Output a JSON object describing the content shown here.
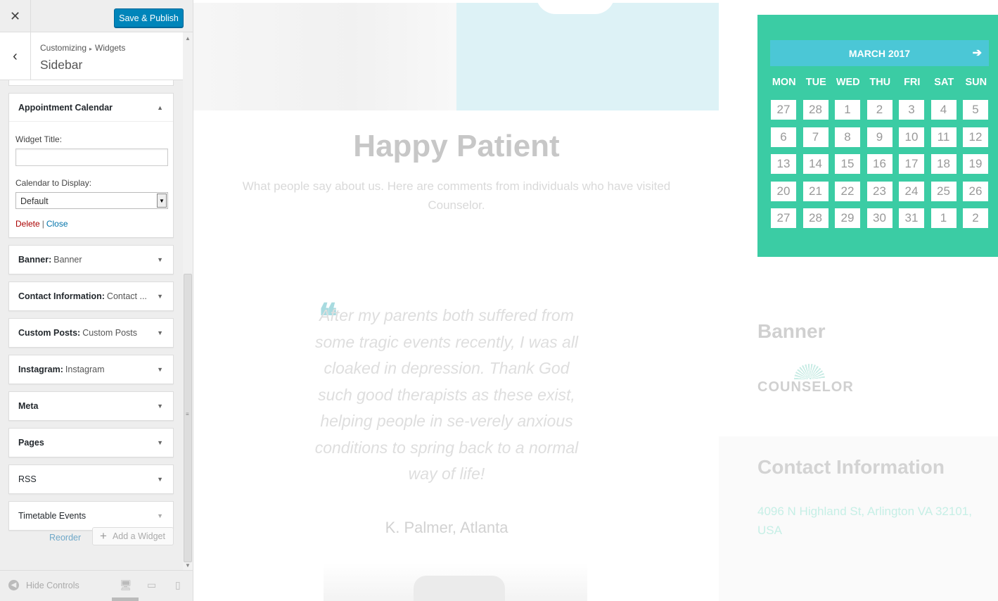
{
  "topbar": {
    "close_glyph": "✕",
    "save_label": "Save & Publish"
  },
  "section": {
    "back_glyph": "‹",
    "breadcrumb_1": "Customizing",
    "breadcrumb_sep": "▸",
    "breadcrumb_2": "Widgets",
    "title": "Sidebar"
  },
  "open_widget": {
    "name": "Appointment Calendar",
    "title_label": "Widget Title:",
    "title_value": "",
    "calendar_label": "Calendar to Display:",
    "calendar_value": "Default",
    "delete_label": "Delete",
    "separator": "|",
    "close_label": "Close"
  },
  "widgets": [
    {
      "name": "Banner:",
      "sub": "Banner"
    },
    {
      "name": "Contact Information:",
      "sub": "Contact ..."
    },
    {
      "name": "Custom Posts:",
      "sub": "Custom Posts"
    },
    {
      "name": "Instagram:",
      "sub": "Instagram"
    },
    {
      "name": "Meta",
      "sub": ""
    },
    {
      "name": "Pages",
      "sub": ""
    },
    {
      "name": "RSS",
      "sub": ""
    },
    {
      "name": "Timetable Events",
      "sub": ""
    }
  ],
  "widget_footer": {
    "reorder_label": "Reorder",
    "add_label": "Add a Widget"
  },
  "footer": {
    "hide_controls": "Hide Controls"
  },
  "preview": {
    "happy_title": "Happy Patient",
    "happy_sub": "What people say about us. Here are comments from individuals who have visited Counselor.",
    "quote_glyph": "❝",
    "quote": "After my parents both suffered from some tragic events recently, I was all cloaked in depression. Thank God such good therapists as these exist, helping people in se-verely anxious conditions to spring back to a normal way of life!",
    "author": "K. Palmer, Atlanta",
    "calendar": {
      "month": "MARCH 2017",
      "next_glyph": "➔",
      "days_of_week": [
        "MON",
        "TUE",
        "WED",
        "THU",
        "FRI",
        "SAT",
        "SUN"
      ],
      "days": [
        "27",
        "28",
        "1",
        "2",
        "3",
        "4",
        "5",
        "6",
        "7",
        "8",
        "9",
        "10",
        "11",
        "12",
        "13",
        "14",
        "15",
        "16",
        "17",
        "18",
        "19",
        "20",
        "21",
        "22",
        "23",
        "24",
        "25",
        "26",
        "27",
        "28",
        "29",
        "30",
        "31",
        "1",
        "2"
      ]
    },
    "banner_title": "Banner",
    "logo_word": "COUNSELOR",
    "contact_title": "Contact Information",
    "contact_address": "4096 N Highland St, Arlington VA 32101, USA"
  },
  "colors": {
    "accent_blue": "#0085ba",
    "calendar_green": "#3bcca4",
    "calendar_header": "#4bc7d6",
    "delete_red": "#aa0000"
  }
}
